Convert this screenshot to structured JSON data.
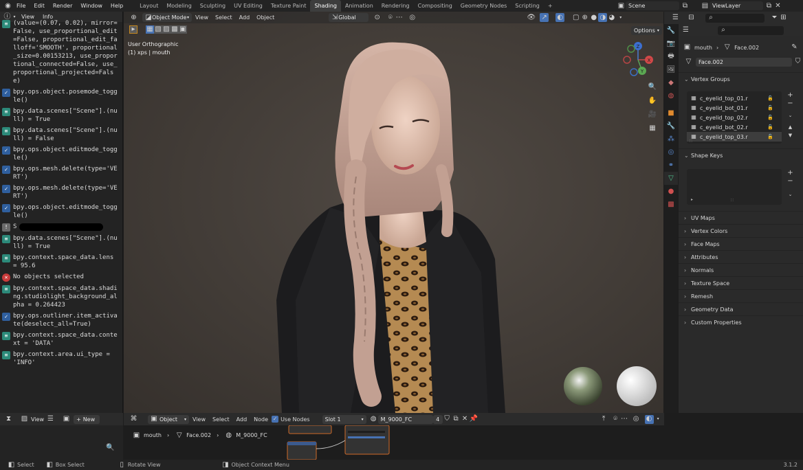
{
  "topbar": {
    "menus": [
      "File",
      "Edit",
      "Render",
      "Window",
      "Help"
    ],
    "workspaces": [
      "Layout",
      "Modeling",
      "Sculpting",
      "UV Editing",
      "Texture Paint",
      "Shading",
      "Animation",
      "Rendering",
      "Compositing",
      "Geometry Nodes",
      "Scripting"
    ],
    "active_workspace": "Shading",
    "add_tab": "+",
    "scene": "Scene",
    "view_layer": "ViewLayer"
  },
  "info": {
    "menus": [
      "View",
      "Info"
    ],
    "log": [
      {
        "kind": "op",
        "text": "(value=(0.07, 0.02), mirror=False, use_proportional_edit=False, proportional_edit_falloff='SMOOTH', proportional_size=0.00153213, use_proportional_connected=False, use_proportional_projected=False)"
      },
      {
        "kind": "ok",
        "text": "bpy.ops.object.posemode_toggle()"
      },
      {
        "kind": "op",
        "text": "bpy.data.scenes[\"Scene\"].(null) = True"
      },
      {
        "kind": "op",
        "text": "bpy.data.scenes[\"Scene\"].(null) = False"
      },
      {
        "kind": "ok",
        "text": "bpy.ops.object.editmode_toggle()"
      },
      {
        "kind": "ok",
        "text": "bpy.ops.mesh.delete(type='VERT')"
      },
      {
        "kind": "ok",
        "text": "bpy.ops.mesh.delete(type='VERT')"
      },
      {
        "kind": "ok",
        "text": "bpy.ops.object.editmode_toggle()"
      },
      {
        "kind": "inf",
        "text": "S"
      },
      {
        "kind": "op",
        "text": "bpy.data.scenes[\"Scene\"].(null) = True"
      },
      {
        "kind": "op",
        "text": "bpy.context.space_data.lens = 95.6"
      },
      {
        "kind": "err",
        "text": "No objects selected"
      },
      {
        "kind": "op",
        "text": "bpy.context.space_data.shading.studiolight_background_alpha = 0.264423"
      },
      {
        "kind": "ok",
        "text": "bpy.ops.outliner.item_activate(deselect_all=True)"
      },
      {
        "kind": "op",
        "text": "bpy.context.space_data.context = 'DATA'"
      },
      {
        "kind": "op",
        "text": "bpy.context.area.ui_type = 'INFO'"
      }
    ]
  },
  "viewport": {
    "mode": "Object Mode",
    "menus": [
      "View",
      "Select",
      "Add",
      "Object"
    ],
    "orientation": "Global",
    "options": "Options",
    "view_name": "User Orthographic",
    "object_info": "(1) xps | mouth",
    "gizmo": {
      "x": "X",
      "y": "Y",
      "z": "Z"
    }
  },
  "props": {
    "breadcrumb_object": "mouth",
    "breadcrumb_mesh": "Face.002",
    "mesh_name": "Face.002",
    "vertex_groups_title": "Vertex Groups",
    "vertex_groups": [
      "c_eyelid_top_01.r",
      "c_eyelid_bot_01.r",
      "c_eyelid_top_02.r",
      "c_eyelid_bot_02.r",
      "c_eyelid_top_03.r"
    ],
    "shape_keys_title": "Shape Keys",
    "sections": [
      "UV Maps",
      "Vertex Colors",
      "Face Maps",
      "Attributes",
      "Normals",
      "Texture Space",
      "Remesh",
      "Geometry Data",
      "Custom Properties"
    ]
  },
  "node_editor": {
    "type": "Object",
    "menus": [
      "View",
      "Select",
      "Add",
      "Node"
    ],
    "use_nodes": "Use Nodes",
    "slot": "Slot 1",
    "material": "M_9000_FC",
    "users": "4",
    "breadcrumb": [
      "mouth",
      "Face.002",
      "M_9000_FC"
    ]
  },
  "timeline": {
    "view": "View",
    "new": "New"
  },
  "status": {
    "select": "Select",
    "box_select": "Box Select",
    "rotate_view": "Rotate View",
    "context_menu": "Object Context Menu",
    "version": "3.1.2"
  },
  "colors": {
    "accent": "#4772b3",
    "hair": "#c9a99a",
    "jacket": "#1c1c1e",
    "leopard": "#b38a52"
  }
}
